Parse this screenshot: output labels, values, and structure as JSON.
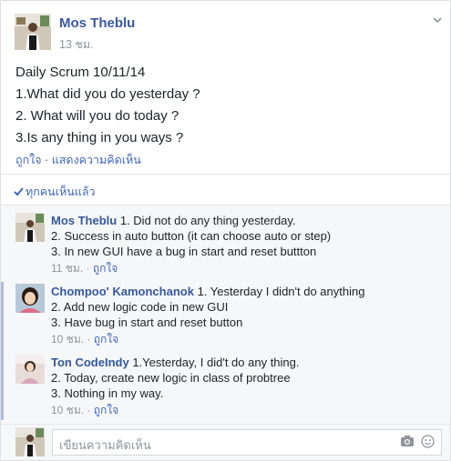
{
  "post": {
    "author": "Mos Theblu",
    "time": "13 ชม.",
    "lines": [
      "Daily Scrum 10/11/14",
      "1.What did you do yesterday ?",
      "2. What will you do today ?",
      "3.Is any thing in you ways ?"
    ],
    "like_label": "ถูกใจ",
    "dot": " · ",
    "comment_label": "แสดงความคิดเห็น"
  },
  "seen": {
    "label": "ทุกคนเห็นแล้ว"
  },
  "comments": [
    {
      "author": "Mos Theblu",
      "lines": [
        "1. Did not do any thing yesterday.",
        "2. Success in auto button (it can choose auto or step)",
        "3. In new GUI have a bug in start and reset buttton"
      ],
      "time": "11 ชม.",
      "like_label": "ถูกใจ"
    },
    {
      "author": "Chompoo' Kamonchanok",
      "lines": [
        "1. Yesterday I didn't do anything",
        "2. Add new logic code in new GUI",
        "3. Have bug in start and reset button"
      ],
      "time": "10 ชม.",
      "like_label": "ถูกใจ"
    },
    {
      "author": "Ton CodeIndy",
      "lines": [
        "1.Yesterday, I did't do any thing.",
        "2. Today, create new logic in class of probtree",
        "3. Nothing in my way."
      ],
      "time": "10 ชม.",
      "like_label": "ถูกใจ"
    }
  ],
  "composer": {
    "placeholder": "เขียนความคิดเห็น"
  },
  "colors": {
    "link": "#3b5998",
    "muted": "#90949c",
    "accent_bar": "#aebde0"
  }
}
